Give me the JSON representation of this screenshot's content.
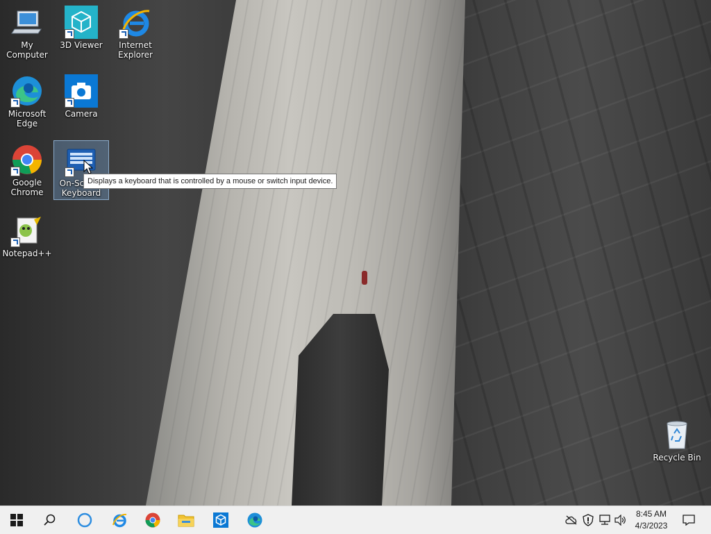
{
  "desktop": {
    "icons": [
      {
        "name": "my-computer",
        "label": "My Computer"
      },
      {
        "name": "3d-viewer",
        "label": "3D Viewer"
      },
      {
        "name": "internet-explorer",
        "label": "Internet Explorer"
      },
      {
        "name": "microsoft-edge",
        "label": "Microsoft Edge"
      },
      {
        "name": "camera",
        "label": "Camera"
      },
      {
        "name": "google-chrome",
        "label": "Google Chrome"
      },
      {
        "name": "on-screen-keyboard",
        "label": "On-Screen Keyboard",
        "selected": true
      },
      {
        "name": "notepad-plus-plus",
        "label": "Notepad++"
      },
      {
        "name": "recycle-bin",
        "label": "Recycle Bin"
      }
    ],
    "tooltip": "Displays a keyboard that is controlled by a mouse or switch input device."
  },
  "taskbar": {
    "pinned": [
      {
        "name": "start",
        "icon": "windows-logo-icon"
      },
      {
        "name": "search",
        "icon": "search-icon"
      },
      {
        "name": "cortana",
        "icon": "cortana-circle-icon"
      },
      {
        "name": "internet-explorer",
        "icon": "internet-explorer-icon"
      },
      {
        "name": "google-chrome",
        "icon": "chrome-icon"
      },
      {
        "name": "file-explorer",
        "icon": "folder-icon"
      },
      {
        "name": "3d-viewer",
        "icon": "cube-icon"
      },
      {
        "name": "microsoft-edge",
        "icon": "edge-icon"
      }
    ],
    "tray": {
      "icons": [
        "onedrive-offline-icon",
        "security-shield-icon",
        "network-icon",
        "volume-icon"
      ],
      "time": "8:45 AM",
      "date": "4/3/2023"
    },
    "notification_icon": "action-center-icon"
  },
  "colors": {
    "taskbar_bg": "#f0f0f0",
    "accent_blue": "#0078d4",
    "tooltip_bg": "#ffffff"
  }
}
